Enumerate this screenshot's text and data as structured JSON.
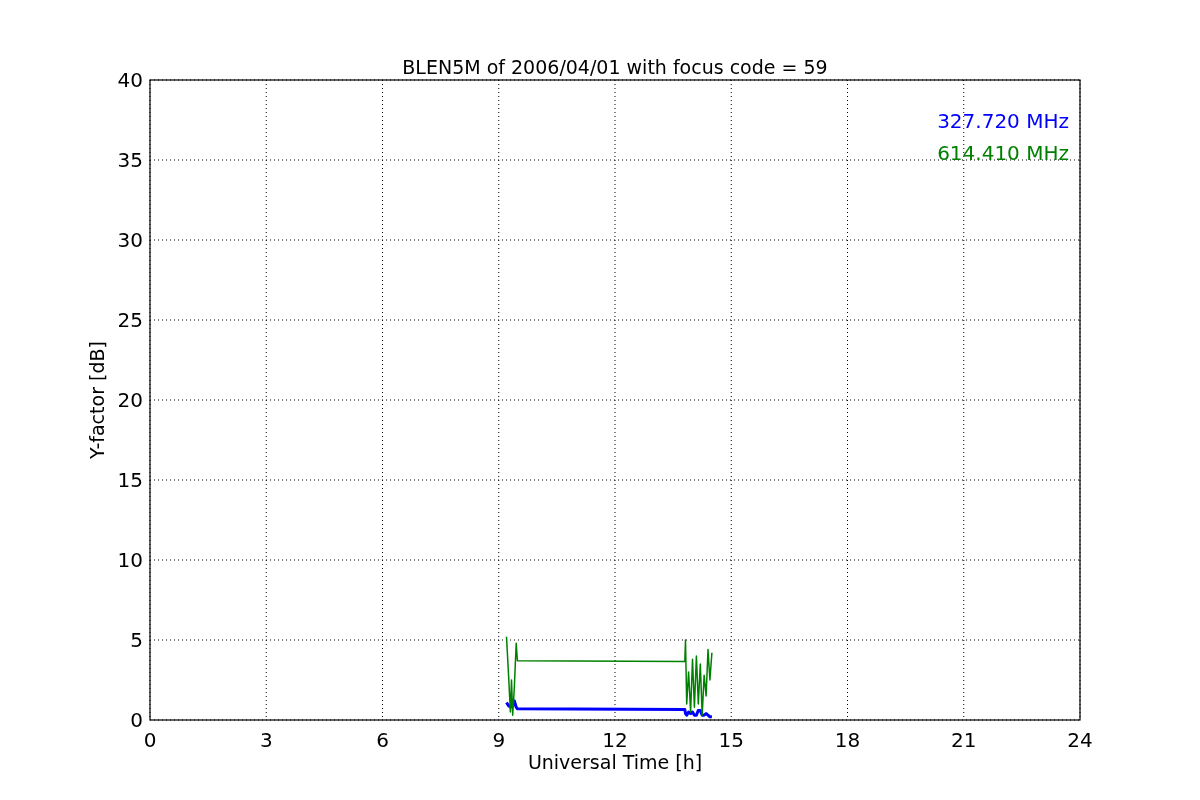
{
  "chart_data": {
    "type": "line",
    "title": "BLEN5M of 2006/04/01 with focus code = 59",
    "xlabel": "Universal Time [h]",
    "ylabel": "Y-factor [dB]",
    "x": [
      9.2,
      9.25,
      9.3,
      9.33,
      9.36,
      9.4,
      9.45,
      9.48,
      13.8,
      13.82,
      13.85,
      13.9,
      13.95,
      14.0,
      14.05,
      14.1,
      14.15,
      14.2,
      14.25,
      14.3,
      14.35,
      14.4,
      14.45,
      14.5
    ],
    "series": [
      {
        "name": "327.720 MHz",
        "color": "#0000ff",
        "values": [
          1.1,
          0.9,
          0.8,
          1.0,
          0.9,
          1.2,
          0.8,
          0.7,
          0.65,
          0.4,
          0.3,
          0.5,
          0.4,
          0.5,
          0.3,
          0.3,
          0.6,
          0.6,
          0.3,
          0.3,
          0.4,
          0.3,
          0.2,
          0.2
        ]
      },
      {
        "name": "614.410 MHz",
        "color": "#008000",
        "values": [
          5.2,
          3,
          0.5,
          2.5,
          0.3,
          2,
          4.8,
          3.7,
          3.65,
          5,
          1,
          3,
          0.5,
          3.8,
          0.8,
          4,
          1,
          3.5,
          0.3,
          2.8,
          1.5,
          4.4,
          2.5,
          4.2
        ]
      }
    ],
    "xlim": [
      0,
      24
    ],
    "ylim": [
      0,
      40
    ],
    "xticks": [
      0,
      3,
      6,
      9,
      12,
      15,
      18,
      21,
      24
    ],
    "yticks": [
      0,
      5,
      10,
      15,
      20,
      25,
      30,
      35,
      40
    ],
    "grid": true
  }
}
